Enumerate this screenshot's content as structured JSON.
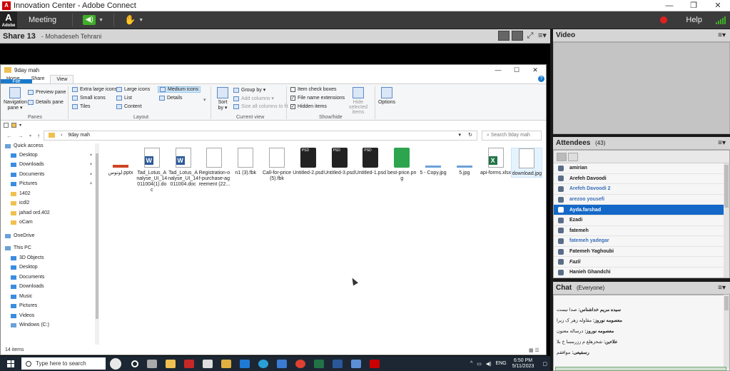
{
  "window": {
    "title": "Innovation Center - Adobe Connect",
    "controls": [
      "—",
      "❐",
      "✕"
    ]
  },
  "connect_bar": {
    "logo": "A",
    "logo_sub": "Adobe",
    "menu_label": "Meeting",
    "help_label": "Help",
    "colors": {
      "speaker_on": "#3fae29",
      "record": "#e02020"
    }
  },
  "share_pod": {
    "title": "Share 13",
    "presenter": "- Mohadeseh Tehrani",
    "menu_icon": "≡▾"
  },
  "explorer": {
    "title": "9day mah",
    "controls": [
      "—",
      "☐",
      "✕"
    ],
    "tabs": [
      "File",
      "Home",
      "Share",
      "View"
    ],
    "ribbon": {
      "panes": {
        "navigation_pane": "Navigation pane ▾",
        "preview_pane": "Preview pane",
        "details_pane": "Details pane",
        "group": "Panes"
      },
      "layout": {
        "extra_large_icons": "Extra large icons",
        "large_icons": "Large icons",
        "medium_icons": "Medium icons",
        "small_icons": "Small icons",
        "list": "List",
        "details": "Details",
        "tiles": "Tiles",
        "content": "Content",
        "group": "Layout"
      },
      "current_view": {
        "sort_by": "Sort by ▾",
        "group_by": "Group by ▾",
        "add_columns": "Add columns ▾",
        "size_all_columns": "Size all columns to fit",
        "group": "Current view"
      },
      "show_hide": {
        "item_check_boxes": "Item check boxes",
        "file_name_extensions": "File name extensions",
        "hidden_items": "Hidden items",
        "hide_selected": "Hide selected items",
        "group": "Show/hide"
      },
      "options": "Options"
    },
    "address": "9day mah",
    "search_placeholder": "Search 9day mah",
    "nav_pane": [
      {
        "label": "Quick access",
        "type": "quick",
        "pinned": false
      },
      {
        "label": "Desktop",
        "type": "blue",
        "pinned": true
      },
      {
        "label": "Downloads",
        "type": "blue",
        "pinned": true
      },
      {
        "label": "Documents",
        "type": "blue",
        "pinned": true
      },
      {
        "label": "Pictures",
        "type": "blue",
        "pinned": true
      },
      {
        "label": "1402",
        "type": "folder",
        "pinned": false
      },
      {
        "label": "icdl2",
        "type": "folder",
        "pinned": false
      },
      {
        "label": "jahad ord.402",
        "type": "folder",
        "pinned": false
      },
      {
        "label": "oCam",
        "type": "folder",
        "pinned": false
      },
      {
        "label": "OneDrive",
        "type": "cloud",
        "pinned": false
      },
      {
        "label": "This PC",
        "type": "pc",
        "pinned": false
      },
      {
        "label": "3D Objects",
        "type": "blue",
        "pinned": false
      },
      {
        "label": "Desktop",
        "type": "blue",
        "pinned": false
      },
      {
        "label": "Documents",
        "type": "blue",
        "pinned": false
      },
      {
        "label": "Downloads",
        "type": "blue",
        "pinned": false
      },
      {
        "label": "Music",
        "type": "blue",
        "pinned": false
      },
      {
        "label": "Pictures",
        "type": "blue",
        "pinned": false
      },
      {
        "label": "Videos",
        "type": "blue",
        "pinned": false
      },
      {
        "label": "Windows (C:)",
        "type": "drive",
        "pinned": false
      }
    ],
    "files": [
      {
        "name": "لوتوس.pptx",
        "kind": "ppt"
      },
      {
        "name": "Tad_Lotus_Analyse_UI_14011004(1).doc",
        "kind": "word"
      },
      {
        "name": "Tad_Lotus_Analyse_UI_14011004.doc",
        "kind": "word"
      },
      {
        "name": "Registration-of-purchase-agreement (22...",
        "kind": "doc"
      },
      {
        "name": "n1 (3).fbk",
        "kind": "doc"
      },
      {
        "name": "Call-for-price (5).fbk",
        "kind": "doc"
      },
      {
        "name": "Untitled-2.psd",
        "kind": "psd"
      },
      {
        "name": "Untitled-3.psd",
        "kind": "psd"
      },
      {
        "name": "Untitled-1.psd",
        "kind": "psd"
      },
      {
        "name": "best-price.png",
        "kind": "png"
      },
      {
        "name": "5 - Copy.jpg",
        "kind": "img"
      },
      {
        "name": "5.jpg",
        "kind": "img"
      },
      {
        "name": "api-forms.xlsx",
        "kind": "xls"
      },
      {
        "name": "download.jpg",
        "kind": "doc"
      }
    ],
    "status": "14 items"
  },
  "taskbar": {
    "search_placeholder": "Type here to search",
    "lang": "ENG",
    "time": "6:50 PM",
    "date": "5/11/2023"
  },
  "video_pod": {
    "title": "Video",
    "menu_icon": "≡▾"
  },
  "attendees_pod": {
    "title": "Attendees",
    "count": "(43)",
    "menu_icon": "≡▾",
    "list": [
      {
        "name": "amirian",
        "style": ""
      },
      {
        "name": "Arefeh Davoodi",
        "style": ""
      },
      {
        "name": "Arefeh Davoodi 2",
        "style": "blue"
      },
      {
        "name": "arezoo yousefi",
        "style": "blue"
      },
      {
        "name": "Ayda.farshad",
        "style": "hl"
      },
      {
        "name": "Ezadi",
        "style": ""
      },
      {
        "name": "fatemeh",
        "style": ""
      },
      {
        "name": "fatemeh yadegar",
        "style": "blue"
      },
      {
        "name": "Fatemeh Yaghoubi",
        "style": ""
      },
      {
        "name": "Fazli",
        "style": "it"
      },
      {
        "name": "Hanieh Ghandchi",
        "style": ""
      }
    ]
  },
  "chat_pod": {
    "title": "Chat",
    "scope": "(Everyone)",
    "menu_icon": "≡▾",
    "messages": [
      {
        "sender": "سیده مریم خداشناس:",
        "text": "صدا نیست"
      },
      {
        "sender": "معصومه نوروز:",
        "text": "مقاوله زهر ک زیرا"
      },
      {
        "sender": "معصومه نوروز:",
        "text": "درساله معنون"
      },
      {
        "sender": "علاءین:",
        "text": "شحزهلع م ززرمسا خ بلا"
      },
      {
        "sender": "رسفیعی:",
        "text": "موافقم"
      }
    ]
  }
}
